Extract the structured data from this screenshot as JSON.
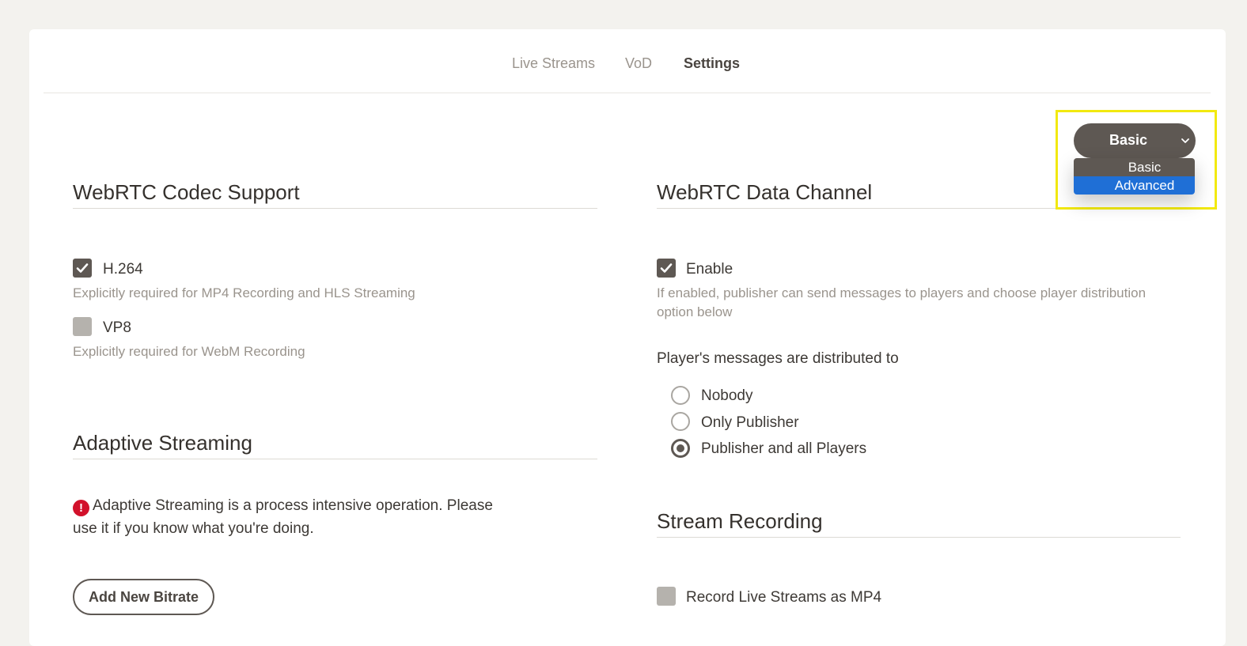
{
  "nav": {
    "tabs": [
      {
        "label": "Live Streams"
      },
      {
        "label": "VoD"
      },
      {
        "label": "Settings",
        "active": true
      }
    ]
  },
  "mode_select": {
    "value": "Basic",
    "options": [
      "Basic",
      "Advanced"
    ],
    "highlighted": "Advanced"
  },
  "codec": {
    "title": "WebRTC Codec Support",
    "h264": {
      "label": "H.264",
      "checked": true,
      "helper": "Explicitly required for MP4 Recording and HLS Streaming"
    },
    "vp8": {
      "label": "VP8",
      "checked": false,
      "helper": "Explicitly required for WebM Recording"
    }
  },
  "adaptive": {
    "title": "Adaptive Streaming",
    "warning_line1": "Adaptive Streaming is a process intensive operation. Please",
    "warning_line2": "use it if you know what you're doing.",
    "add_button": "Add New Bitrate"
  },
  "data_channel": {
    "title": "WebRTC Data Channel",
    "enable": {
      "label": "Enable",
      "checked": true
    },
    "helper_line1": "If enabled, publisher can send messages to players and choose player distribution",
    "helper_line2": "option below",
    "distribution_label": "Player's messages are distributed to",
    "options": [
      {
        "label": "Nobody",
        "selected": false
      },
      {
        "label": "Only Publisher",
        "selected": false
      },
      {
        "label": "Publisher and all Players",
        "selected": true
      }
    ]
  },
  "recording": {
    "title": "Stream Recording",
    "mp4": {
      "label": "Record Live Streams as MP4",
      "checked": false
    }
  },
  "colors": {
    "primary": "#5e5853",
    "highlight_option": "#1f6fd6",
    "warning": "#d2112b",
    "annotation": "#f2e90f"
  }
}
